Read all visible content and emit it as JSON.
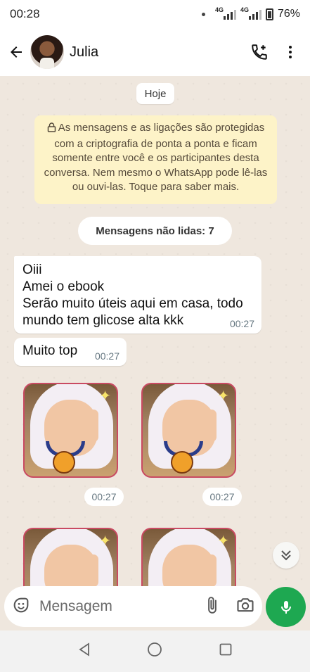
{
  "status_bar": {
    "time": "00:28",
    "network1": "4G",
    "network2": "4G",
    "battery": "76%"
  },
  "header": {
    "contact_name": "Julia"
  },
  "chat": {
    "date_label": "Hoje",
    "encryption_notice": "As mensagens e as ligações são protegidas com a criptografia de ponta a ponta e ficam somente entre você e os participantes desta conversa. Nem mesmo o WhatsApp pode lê-las ou ouvi-las. Toque para saber mais.",
    "unread_label": "Mensagens não lidas: 7",
    "messages": [
      {
        "text": "Oiii\nAmei o ebook\nSerão muito úteis aqui em casa, todo mundo tem glicose alta kkk",
        "time": "00:27"
      },
      {
        "text": "Muito top",
        "time": "00:27"
      }
    ],
    "stickers": [
      {
        "time": "00:27"
      },
      {
        "time": "00:27"
      }
    ]
  },
  "composer": {
    "placeholder": "Mensagem"
  },
  "colors": {
    "accent": "#1ea851",
    "notice_bg": "#fdf3c8",
    "chat_bg": "#efe7de"
  },
  "icons": [
    "back-arrow",
    "add-call",
    "more-vert",
    "lock",
    "chevrons-down",
    "sticker",
    "attach",
    "camera",
    "mic",
    "nav-back",
    "nav-home",
    "nav-recents"
  ]
}
